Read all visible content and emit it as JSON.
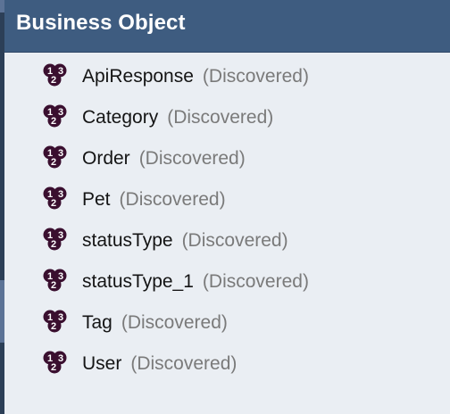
{
  "panel": {
    "title": "Business Object"
  },
  "items": [
    {
      "name": "ApiResponse",
      "status": "(Discovered)",
      "icon": "enumeration-icon"
    },
    {
      "name": "Category",
      "status": "(Discovered)",
      "icon": "enumeration-icon"
    },
    {
      "name": "Order",
      "status": "(Discovered)",
      "icon": "enumeration-icon"
    },
    {
      "name": "Pet",
      "status": "(Discovered)",
      "icon": "enumeration-icon"
    },
    {
      "name": "statusType",
      "status": "(Discovered)",
      "icon": "enumeration-icon"
    },
    {
      "name": "statusType_1",
      "status": "(Discovered)",
      "icon": "enumeration-icon"
    },
    {
      "name": "Tag",
      "status": "(Discovered)",
      "icon": "enumeration-icon"
    },
    {
      "name": "User",
      "status": "(Discovered)",
      "icon": "enumeration-icon"
    }
  ],
  "icon_glyphs": {
    "top": "1",
    "right": "3",
    "bottom": "2"
  },
  "colors": {
    "header_bg": "#3e5c80",
    "panel_bg": "#eaeef3",
    "icon_fill": "#3a0f2f",
    "icon_text": "#ffffff",
    "status_text": "#7a7a7a"
  }
}
